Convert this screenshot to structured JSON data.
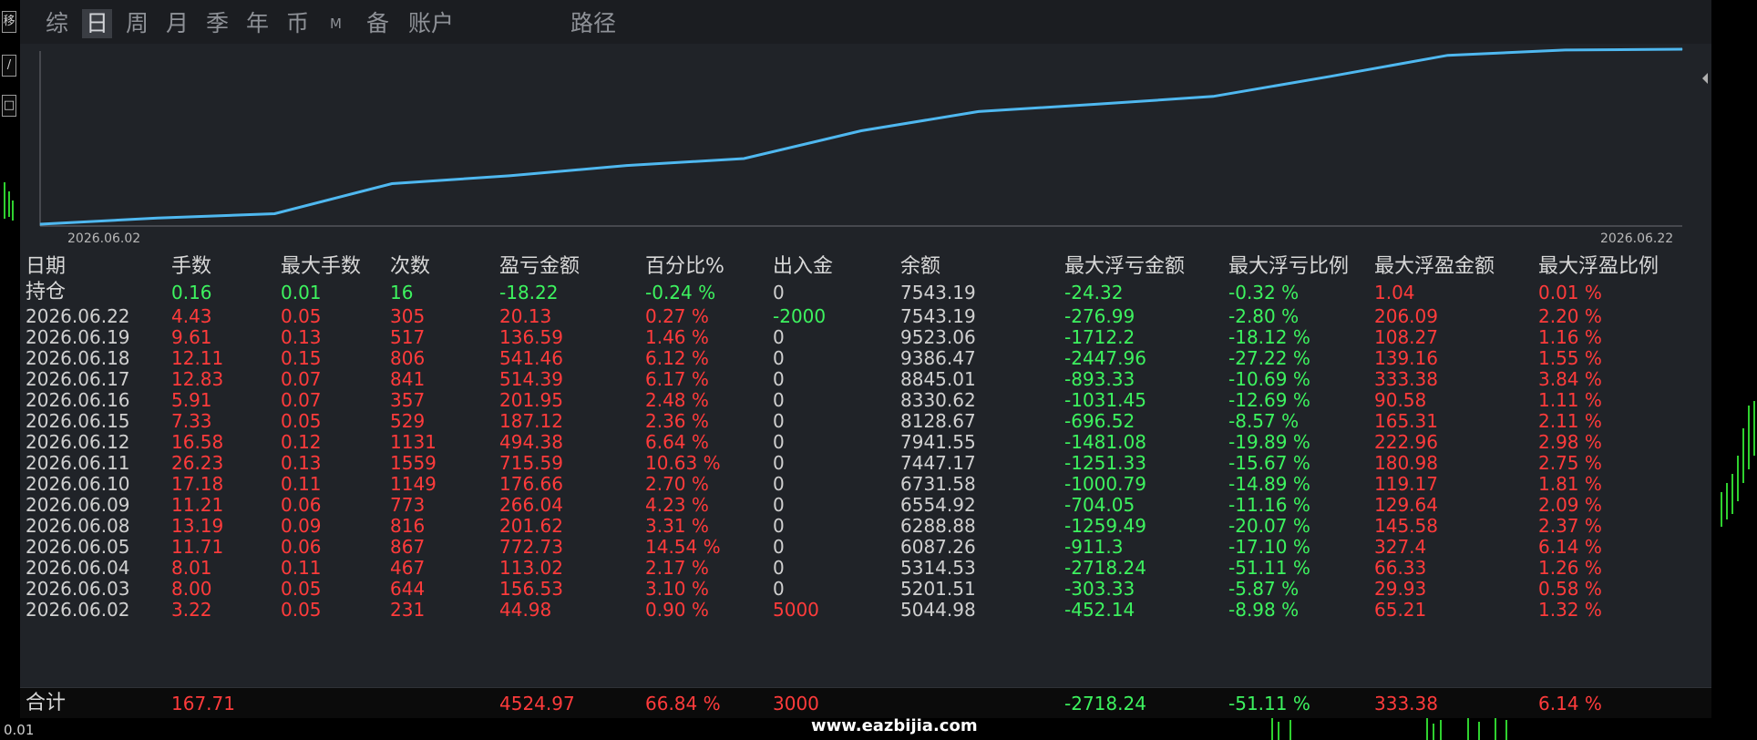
{
  "tabs": [
    {
      "label": "综",
      "active": false
    },
    {
      "label": "日",
      "active": true
    },
    {
      "label": "周",
      "active": false
    },
    {
      "label": "月",
      "active": false
    },
    {
      "label": "季",
      "active": false
    },
    {
      "label": "年",
      "active": false
    },
    {
      "label": "币",
      "active": false
    },
    {
      "label": "M",
      "active": false
    },
    {
      "label": "备",
      "active": false
    },
    {
      "label": "账户",
      "active": false
    },
    {
      "label": "路径",
      "active": false
    }
  ],
  "side_buttons": [
    "移",
    "/",
    "□"
  ],
  "chart_data": {
    "type": "line",
    "x": [
      "2026.06.02",
      "2026.06.03",
      "2026.06.04",
      "2026.06.05",
      "2026.06.08",
      "2026.06.09",
      "2026.06.10",
      "2026.06.11",
      "2026.06.12",
      "2026.06.15",
      "2026.06.16",
      "2026.06.17",
      "2026.06.18",
      "2026.06.19",
      "2026.06.22"
    ],
    "y": [
      44.98,
      201.51,
      314.53,
      1087.26,
      1288.88,
      1554.92,
      1731.58,
      2447.17,
      2941.55,
      3128.67,
      3330.62,
      3845.01,
      4386.47,
      4523.06,
      4543.19
    ],
    "x_tick_labels": [
      "2026.06.02",
      "2026.06.22"
    ],
    "line_color": "#4fb8f0",
    "grid": false
  },
  "table": {
    "headers": [
      "日期",
      "手数",
      "最大手数",
      "次数",
      "盈亏金额",
      "百分比%",
      "出入金",
      "余额",
      "最大浮亏金额",
      "最大浮亏比例",
      "最大浮盈金额",
      "最大浮盈比例"
    ],
    "holding": [
      "持仓",
      "0.16",
      "0.01",
      "16",
      "-18.22",
      "-0.24 %",
      "0",
      "7543.19",
      "-24.32",
      "-0.32 %",
      "1.04",
      "0.01 %"
    ],
    "rows": [
      [
        "2026.06.22",
        "4.43",
        "0.05",
        "305",
        "20.13",
        "0.27 %",
        "-2000",
        "7543.19",
        "-276.99",
        "-2.80 %",
        "206.09",
        "2.20 %"
      ],
      [
        "2026.06.19",
        "9.61",
        "0.13",
        "517",
        "136.59",
        "1.46 %",
        "0",
        "9523.06",
        "-1712.2",
        "-18.12 %",
        "108.27",
        "1.16 %"
      ],
      [
        "2026.06.18",
        "12.11",
        "0.15",
        "806",
        "541.46",
        "6.12 %",
        "0",
        "9386.47",
        "-2447.96",
        "-27.22 %",
        "139.16",
        "1.55 %"
      ],
      [
        "2026.06.17",
        "12.83",
        "0.07",
        "841",
        "514.39",
        "6.17 %",
        "0",
        "8845.01",
        "-893.33",
        "-10.69 %",
        "333.38",
        "3.84 %"
      ],
      [
        "2026.06.16",
        "5.91",
        "0.07",
        "357",
        "201.95",
        "2.48 %",
        "0",
        "8330.62",
        "-1031.45",
        "-12.69 %",
        "90.58",
        "1.11 %"
      ],
      [
        "2026.06.15",
        "7.33",
        "0.05",
        "529",
        "187.12",
        "2.36 %",
        "0",
        "8128.67",
        "-696.52",
        "-8.57 %",
        "165.31",
        "2.11 %"
      ],
      [
        "2026.06.12",
        "16.58",
        "0.12",
        "1131",
        "494.38",
        "6.64 %",
        "0",
        "7941.55",
        "-1481.08",
        "-19.89 %",
        "222.96",
        "2.98 %"
      ],
      [
        "2026.06.11",
        "26.23",
        "0.13",
        "1559",
        "715.59",
        "10.63 %",
        "0",
        "7447.17",
        "-1251.33",
        "-15.67 %",
        "180.98",
        "2.75 %"
      ],
      [
        "2026.06.10",
        "17.18",
        "0.11",
        "1149",
        "176.66",
        "2.70 %",
        "0",
        "6731.58",
        "-1000.79",
        "-14.89 %",
        "119.17",
        "1.81 %"
      ],
      [
        "2026.06.09",
        "11.21",
        "0.06",
        "773",
        "266.04",
        "4.23 %",
        "0",
        "6554.92",
        "-704.05",
        "-11.16 %",
        "129.64",
        "2.09 %"
      ],
      [
        "2026.06.08",
        "13.19",
        "0.09",
        "816",
        "201.62",
        "3.31 %",
        "0",
        "6288.88",
        "-1259.49",
        "-20.07 %",
        "145.58",
        "2.37 %"
      ],
      [
        "2026.06.05",
        "11.71",
        "0.06",
        "867",
        "772.73",
        "14.54 %",
        "0",
        "6087.26",
        "-911.3",
        "-17.10 %",
        "327.4",
        "6.14 %"
      ],
      [
        "2026.06.04",
        "8.01",
        "0.11",
        "467",
        "113.02",
        "2.17 %",
        "0",
        "5314.53",
        "-2718.24",
        "-51.11 %",
        "66.33",
        "1.26 %"
      ],
      [
        "2026.06.03",
        "8.00",
        "0.05",
        "644",
        "156.53",
        "3.10 %",
        "0",
        "5201.51",
        "-303.33",
        "-5.87 %",
        "29.93",
        "0.58 %"
      ],
      [
        "2026.06.02",
        "3.22",
        "0.05",
        "231",
        "44.98",
        "0.90 %",
        "5000",
        "5044.98",
        "-452.14",
        "-8.98 %",
        "65.21",
        "1.32 %"
      ]
    ],
    "total": [
      "合计",
      "167.71",
      "",
      "",
      "4524.97",
      "66.84 %",
      "3000",
      "",
      "-2718.24",
      "-51.11 %",
      "333.38",
      "6.14 %"
    ]
  },
  "colors": {
    "positive": "#ff3b3b",
    "negative": "#3df35f",
    "neutral": "#d0d0d0",
    "line": "#4fb8f0"
  },
  "bottom_left_text": "0.01",
  "watermark": "www.eazbijia.com"
}
